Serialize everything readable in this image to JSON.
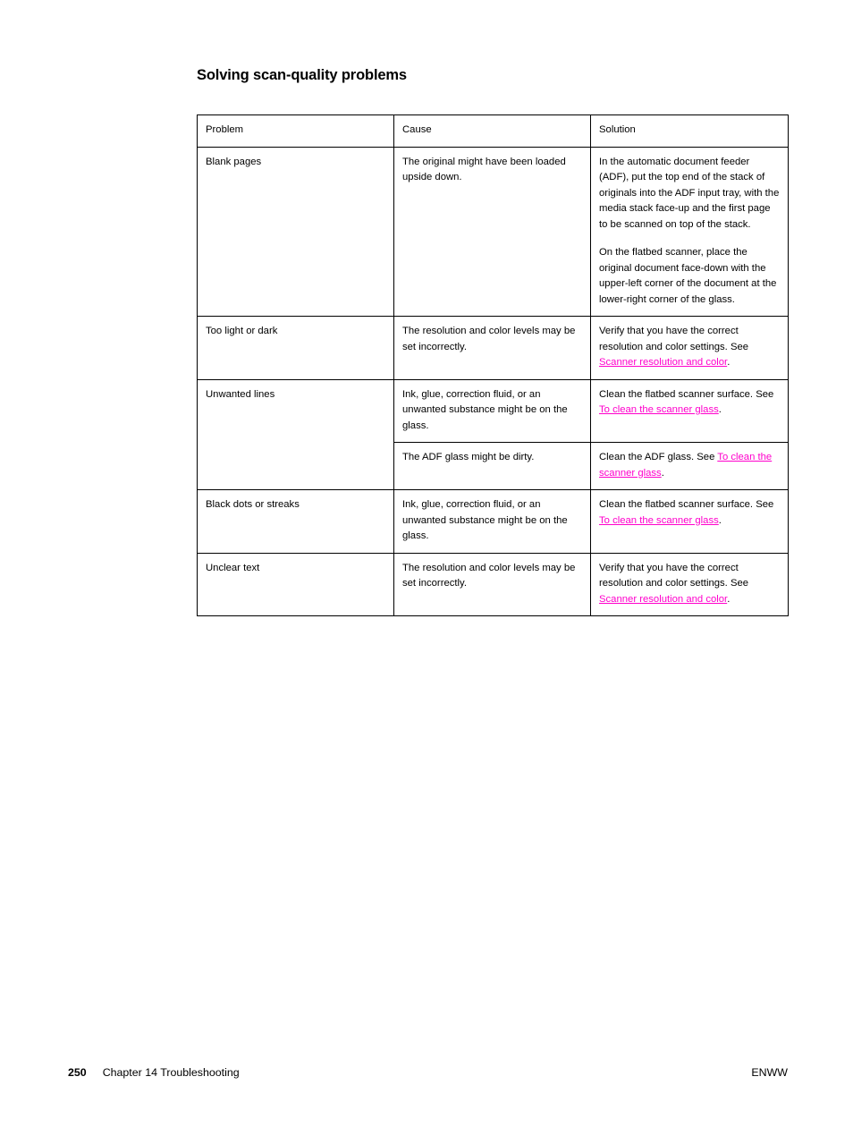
{
  "document": {
    "heading": "Solving scan-quality problems",
    "link_color": "#ff00cc"
  },
  "table": {
    "columns": [
      "Problem",
      "Cause",
      "Solution"
    ],
    "rows": [
      {
        "problem": "Blank pages",
        "cause": "The original might have been loaded upside down.",
        "solution_p1": "In the automatic document feeder (ADF), put the top end of the stack of originals into the ADF input tray, with the media stack face-up and the first page to be scanned on top of the stack.",
        "solution_p2": "On the flatbed scanner, place the original document face-down with the upper-left corner of the document at the lower-right corner of the glass."
      },
      {
        "problem": "Too light or dark",
        "cause": "The resolution and color levels may be set incorrectly.",
        "solution_prefix": "Verify that you have the correct resolution and color settings. See ",
        "solution_link": "Scanner resolution and color",
        "solution_suffix": "."
      },
      {
        "problem": "Unwanted lines",
        "cause": "Ink, glue, correction fluid, or an unwanted substance might be on the glass.",
        "solution_prefix": "Clean the flatbed scanner surface. See ",
        "solution_link": "To clean the scanner glass",
        "solution_suffix": "."
      },
      {
        "problem": "",
        "cause": "The ADF glass might be dirty.",
        "solution_prefix": "Clean the ADF glass. See ",
        "solution_link": "To clean the scanner glass",
        "solution_suffix": "."
      },
      {
        "problem": "Black dots or streaks",
        "cause": "Ink, glue, correction fluid, or an unwanted substance might be on the glass.",
        "solution_prefix": "Clean the flatbed scanner surface. See ",
        "solution_link": "To clean the scanner glass",
        "solution_suffix": "."
      },
      {
        "problem": "Unclear text",
        "cause": "The resolution and color levels may be set incorrectly.",
        "solution_prefix": "Verify that you have the correct resolution and color settings. See ",
        "solution_link": "Scanner resolution and color",
        "solution_suffix": "."
      }
    ]
  },
  "footer": {
    "page_number": "250",
    "chapter": "Chapter 14  Troubleshooting",
    "imprint": "ENWW"
  }
}
